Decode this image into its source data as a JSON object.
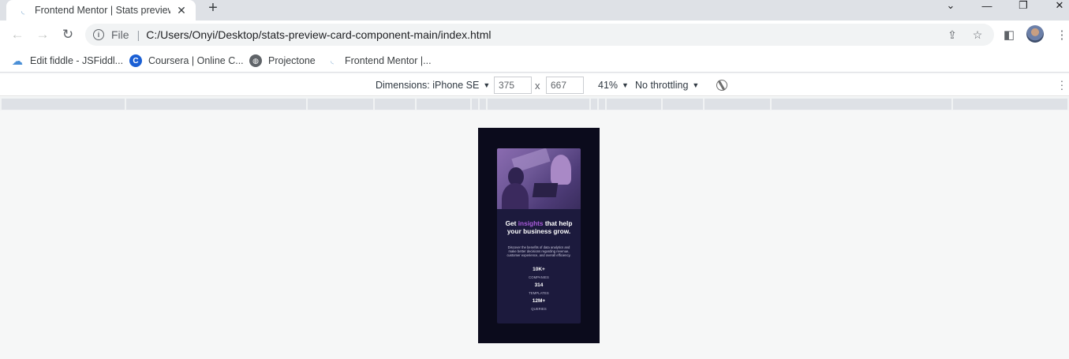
{
  "browser": {
    "tab_title": "Frontend Mentor | Stats preview card component",
    "address_scheme": "File",
    "url": "C:/Users/Onyi/Desktop/stats-preview-card-component-main/index.html"
  },
  "bookmarks": [
    {
      "label": "Edit fiddle - JSFiddl...",
      "icon": "cloud-icon"
    },
    {
      "label": "Coursera | Online C...",
      "icon": "coursera-icon"
    },
    {
      "label": "Projectone",
      "icon": "globe-icon"
    },
    {
      "label": "Frontend Mentor |...",
      "icon": "frontend-mentor-icon"
    }
  ],
  "devtools": {
    "dimensions_label": "Dimensions: iPhone SE",
    "width": "375",
    "height": "667",
    "zoom": "41%",
    "throttling": "No throttling"
  },
  "card": {
    "title_before": "Get ",
    "title_accent": "insights",
    "title_after": " that help your business grow.",
    "description": "Discover the benefits of data analytics and make better decisions regarding revenue, customer experience, and overall efficiency.",
    "stats": [
      {
        "value": "10K+",
        "label": "COMPANIES"
      },
      {
        "value": "314",
        "label": "TEMPLATES"
      },
      {
        "value": "12M+",
        "label": "QUERIES"
      }
    ]
  },
  "colors": {
    "page_bg": "#0b0b1c",
    "card_bg": "#1c1a3d",
    "accent": "#aa5cdb"
  }
}
